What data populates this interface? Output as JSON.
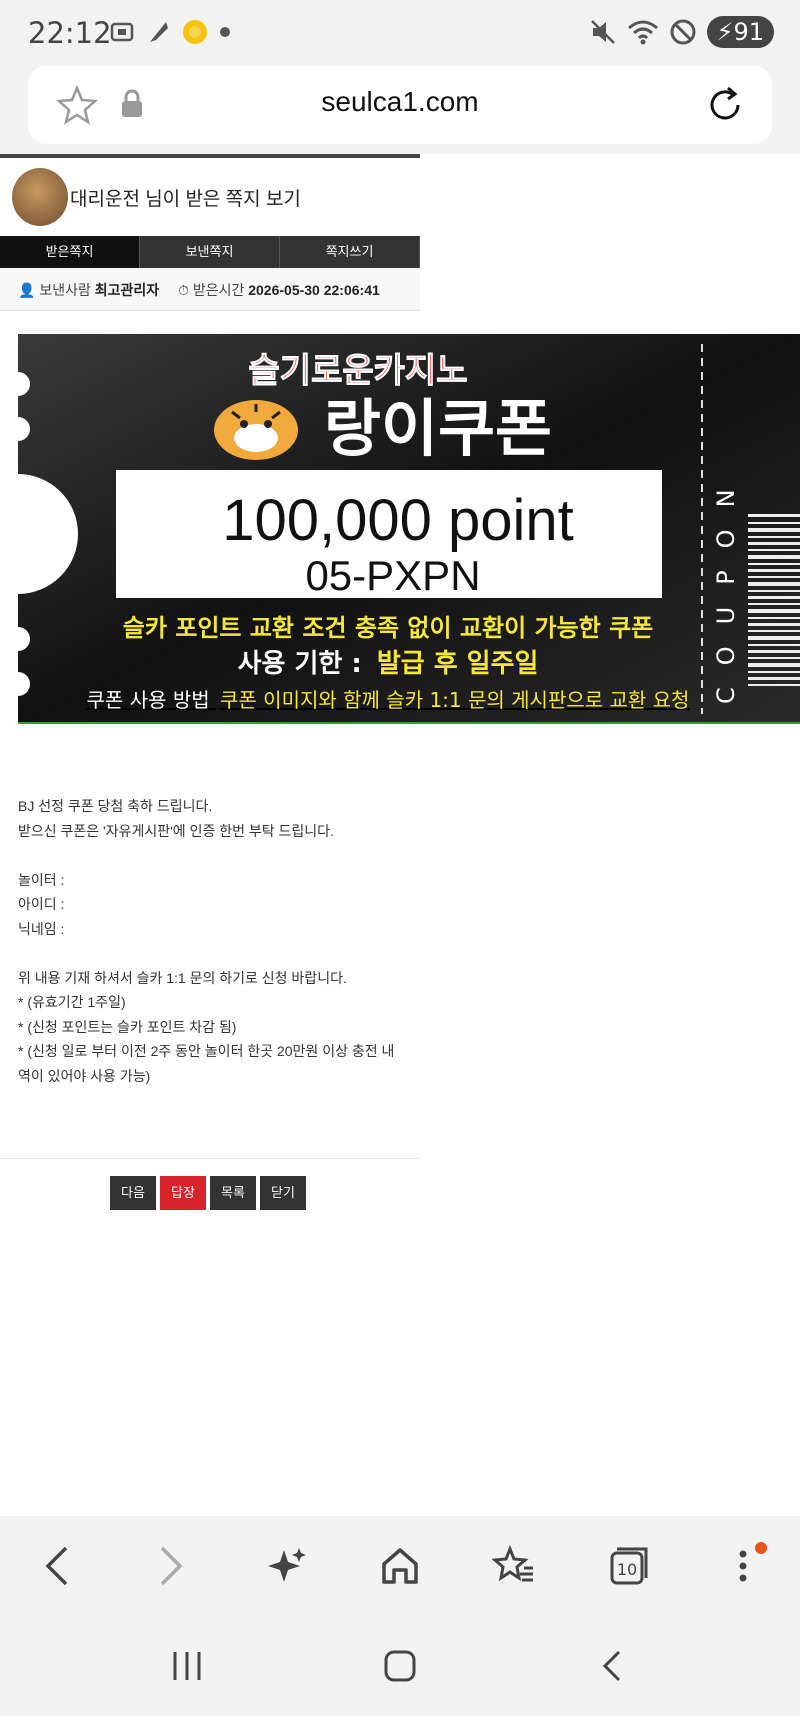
{
  "status_bar": {
    "time": "22:12",
    "battery": "91"
  },
  "browser": {
    "url": "seulca1.com"
  },
  "page": {
    "title": "대리운전 님이 받은 쪽지 보기",
    "tabs": [
      "받은쪽지",
      "보낸쪽지",
      "쪽지쓰기"
    ],
    "sender_label": "보낸사람",
    "sender_value": "최고관리자",
    "received_label": "받은시간",
    "received_value": "2026-05-30 22:06:41"
  },
  "coupon": {
    "brand": "슬기로운카지노",
    "name": "랑이쿠폰",
    "amount": "100,000 point",
    "code": "05-PXPN",
    "line1": "슬카 포인트 교환 조건 충족 없이 교환이 가능한 쿠폰",
    "line2_label": "사용 기한 :",
    "line2_value": "발급 후 일주일",
    "line3_label": "쿠폰 사용 방법",
    "line3_value": "쿠폰 이미지와 함께 슬카 1:1 문의 게시판으로 교환 요청",
    "side_text": "COUPON"
  },
  "message_lines": [
    "BJ 선정 쿠폰 당첨 축하 드립니다.",
    "받으신 쿠폰은 '자유게시판'에 인증 한번 부탁 드립니다.",
    "",
    "놀이터 :",
    "아이디 :",
    "닉네임 :",
    "",
    "위 내용 기재 하셔서 슬카 1:1 문의 하기로 신청 바랍니다.",
    "* (유효기간 1주일)",
    "* (신청 포인트는 슬카 포인트 차감 됨)",
    "* (신청 일로 부터 이전 2주 동안 놀이터 한곳 20만원 이상 충전 내역이 있어야 사용 가능)"
  ],
  "buttons": {
    "next": "다음",
    "reply": "답장",
    "list": "목록",
    "close": "닫기"
  },
  "bottom_nav": {
    "tabs_count": "10"
  },
  "colors": {
    "reply_button": "#d9232b",
    "dark_button": "#333333",
    "coupon_yellow": "#f5e63b",
    "coupon_red": "#e0221c"
  }
}
